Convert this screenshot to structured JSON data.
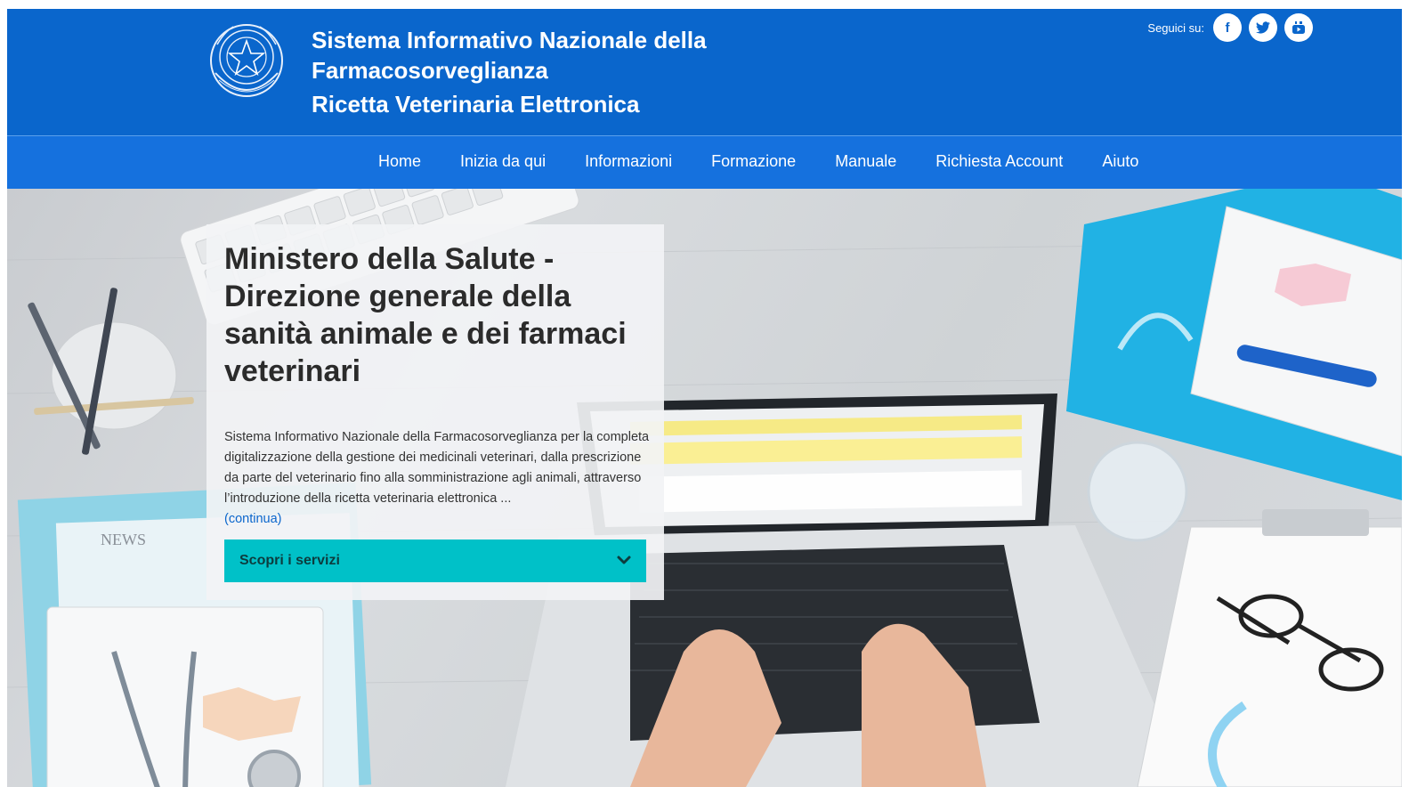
{
  "header": {
    "title_line1": "Sistema Informativo Nazionale della",
    "title_line2": "Farmacosorveglianza",
    "title_line3": "Ricetta Veterinaria Elettronica",
    "social_label": "Seguici su:",
    "social": [
      {
        "icon": "facebook-icon",
        "glyph": "f"
      },
      {
        "icon": "twitter-icon",
        "glyph": "t"
      },
      {
        "icon": "youtube-icon",
        "glyph": "▶"
      }
    ]
  },
  "nav": {
    "items": [
      "Home",
      "Inizia da qui",
      "Informazioni",
      "Formazione",
      "Manuale",
      "Richiesta Account",
      "Aiuto"
    ]
  },
  "hero": {
    "heading": "Ministero della Salute - Direzione generale della sanità animale e dei farmaci veterinari",
    "description": "Sistema Informativo Nazionale della Farmacosorveglianza per la completa digitalizzazione della gestione dei medicinali veterinari, dalla prescrizione da parte del veterinario fino alla somministrazione agli animali, attraverso l’introduzione della ricetta veterinaria elettronica ...",
    "more_link": "(continua)",
    "button_label": "Scopri i servizi"
  },
  "colors": {
    "header_bg": "#0a66cc",
    "nav_bg": "#1571de",
    "button_bg": "#00c1c8"
  }
}
